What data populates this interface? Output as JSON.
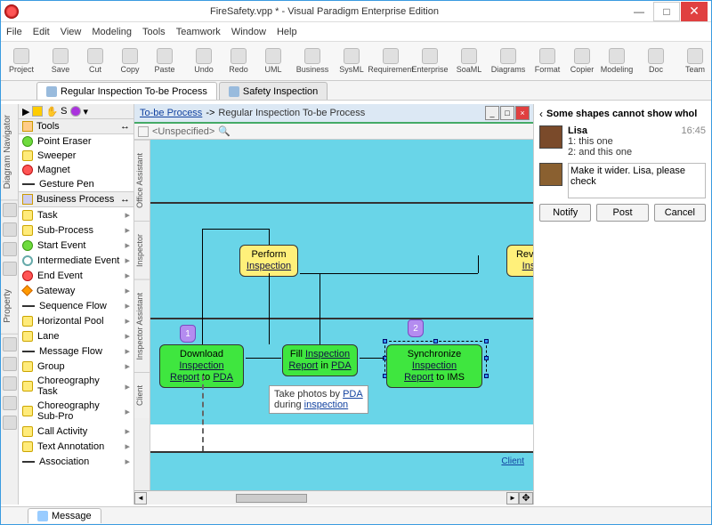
{
  "window": {
    "title": "FireSafety.vpp * - Visual Paradigm Enterprise Edition"
  },
  "menu": [
    "File",
    "Edit",
    "View",
    "Modeling",
    "Tools",
    "Teamwork",
    "Window",
    "Help"
  ],
  "toolbar": [
    {
      "label": "Project"
    },
    {
      "sep": true
    },
    {
      "label": "Save"
    },
    {
      "label": "Cut"
    },
    {
      "label": "Copy"
    },
    {
      "label": "Paste"
    },
    {
      "sep": true
    },
    {
      "label": "Undo"
    },
    {
      "label": "Redo"
    },
    {
      "label": "UML"
    },
    {
      "sep": true
    },
    {
      "label": "Business"
    },
    {
      "sep": true
    },
    {
      "label": "SysML"
    },
    {
      "sep": true
    },
    {
      "label": "Requirement"
    },
    {
      "sep": true
    },
    {
      "label": "Enterprise"
    },
    {
      "sep": true
    },
    {
      "label": "SoaML"
    },
    {
      "sep": true
    },
    {
      "label": "Diagrams"
    },
    {
      "sep": true
    },
    {
      "label": "Format"
    },
    {
      "label": "Copier"
    },
    {
      "label": "Modeling"
    },
    {
      "sep": true
    },
    {
      "label": "Doc"
    },
    {
      "sep": true
    },
    {
      "label": "Team"
    }
  ],
  "tabs": [
    {
      "label": "Regular Inspection To-be Process",
      "active": true
    },
    {
      "label": "Safety Inspection",
      "active": false
    }
  ],
  "leftIconTabs": [
    "Diagram Navigator",
    "Property"
  ],
  "palette": {
    "tools_label": "Tools",
    "tools": [
      "Point Eraser",
      "Sweeper",
      "Magnet",
      "Gesture Pen"
    ],
    "bp_label": "Business Process",
    "bp_items": [
      "Task",
      "Sub-Process",
      "Start Event",
      "Intermediate Event",
      "End Event",
      "Gateway",
      "Sequence Flow",
      "Horizontal Pool",
      "Lane",
      "Message Flow",
      "Group",
      "Choreography Task",
      "Choreography Sub-Pro",
      "Call Activity",
      "Text Annotation",
      "Association"
    ]
  },
  "breadcrumb": {
    "root": "To-be Process",
    "sep": "->",
    "page": "Regular Inspection To-be Process"
  },
  "subbar": {
    "unspec": "<Unspecified>"
  },
  "canvasSideTabs": [
    "Office Assistant",
    "Inspector",
    "Inspector Assistant",
    "Client"
  ],
  "diagram": {
    "perform": {
      "l1": "Perform",
      "l2": "Inspection"
    },
    "review": {
      "l1": "Revie",
      "l2": "Ins"
    },
    "download": {
      "t": "Download ",
      "u1": "Inspection",
      "r": "Report",
      "to": " to ",
      "u2": "PDA"
    },
    "fill": {
      "t": "Fill ",
      "u1": "Inspection",
      "r": "Report",
      "in": " in ",
      "u2": "PDA"
    },
    "sync": {
      "t": "Synchronize ",
      "u1": "Inspection",
      "r": "Report",
      "to": " to IMS"
    },
    "note": {
      "t1": "Take photos by ",
      "u1": "PDA",
      "t2": "during ",
      "u2": "inspection"
    },
    "badges": {
      "b1": "1",
      "b2": "2"
    },
    "client": "Client"
  },
  "comments": {
    "title": "Some shapes cannot show whol",
    "msg": {
      "name": "Lisa",
      "time": "16:45",
      "l1": "1:   this one",
      "l2": "2:   and this one"
    },
    "reply_value": "Make it wider. Lisa, please check",
    "btn_notify": "Notify",
    "btn_post": "Post",
    "btn_cancel": "Cancel"
  },
  "bottom": {
    "tab": "Message"
  }
}
